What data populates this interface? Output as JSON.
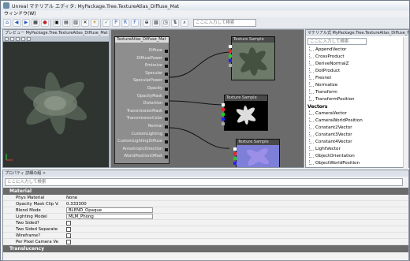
{
  "window": {
    "title": "Unreal マテリアル エディタ: MyPackage.Tree.TextureAtlas_Diffuse_Mat"
  },
  "menu": {
    "window": "ウィンドウ(W)"
  },
  "toolbar": {
    "search_placeholder": "ここに入力して検索"
  },
  "preview": {
    "title": "プレビュー MyPackage.Tree.TextureAtlas_Diffuse_Mat"
  },
  "graph": {
    "material_node_title": "TextureAtlas_Diffuse_Mat",
    "inputs": [
      "Diffuse",
      "DiffusePower",
      "Emissive",
      "Specular",
      "SpecularPower",
      "Opacity",
      "OpacityMask",
      "Distortion",
      "TransmissionMask",
      "TransmissionColor",
      "Normal",
      "CustomLighting",
      "CustomLightingDiffuse",
      "AnisotropicDirection",
      "WorldPositionOffset"
    ],
    "texture_nodes": [
      "Texture Sample",
      "Texture Sample",
      "Texture Sample"
    ]
  },
  "library": {
    "title": "マテリアル式 MyPackage.Tree.TextureAtlas_Diffuse_Mat",
    "search_placeholder": "ここに入力して検索",
    "items_top": [
      "AppendVector",
      "CrossProduct",
      "DeriveNormalZ",
      "DotProduct",
      "Fresnel",
      "Normalize",
      "Transform",
      "TransformPosition"
    ],
    "vectors_label": "Vectors",
    "items_vectors": [
      "CameraVector",
      "CameraWorldPosition",
      "Constant2Vector",
      "Constant3Vector",
      "Constant4Vector",
      "LightVector",
      "ObjectOrientation",
      "ObjectWorldPosition"
    ]
  },
  "properties": {
    "title": "プロパティ 詳細の組 >",
    "search_placeholder": "ここに入力して検索",
    "category_material": "Material",
    "category_translucency": "Translucency",
    "rows": [
      {
        "label": "Phys Material",
        "value": "None"
      },
      {
        "label": "Opacity Mask Clip Value",
        "value": "0.333300"
      },
      {
        "label": "Blend Mode",
        "value": "BLEND_Opaque"
      },
      {
        "label": "Lighting Model",
        "value": "MLM_Phong"
      },
      {
        "label": "Two Sided?",
        "value": ""
      },
      {
        "label": "Two Sided Separate Pass",
        "value": ""
      },
      {
        "label": "Wireframe?",
        "value": ""
      },
      {
        "label": "Per Pixel Camera Vector",
        "value": ""
      }
    ]
  }
}
